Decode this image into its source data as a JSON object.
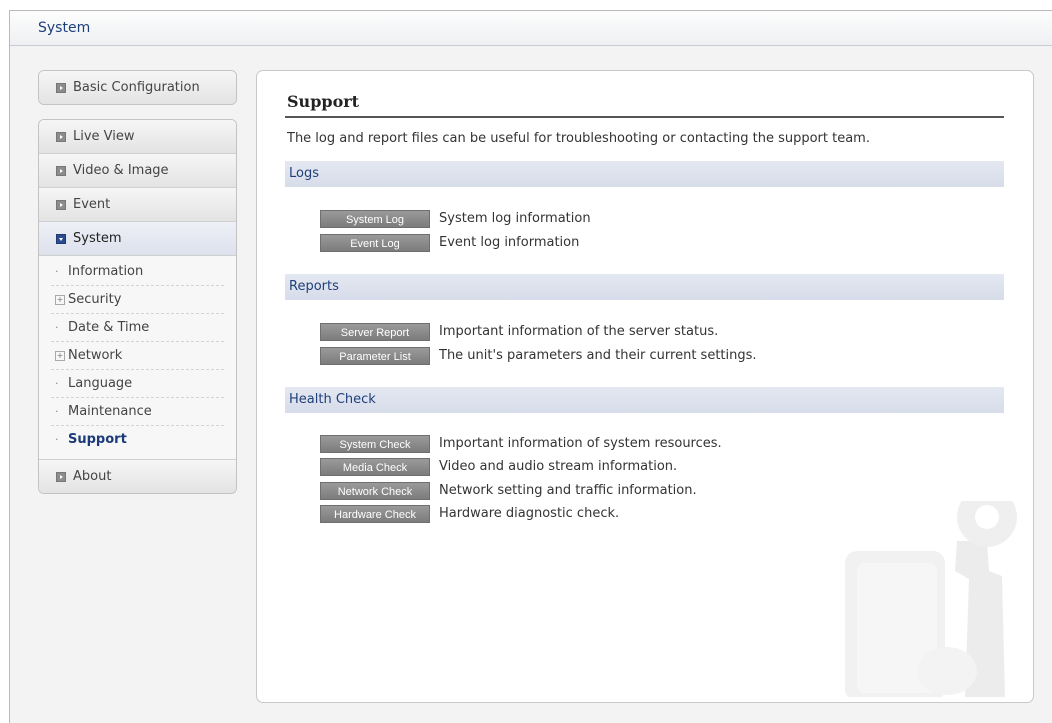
{
  "window": {
    "title": "System"
  },
  "nav": {
    "basic_configuration": "Basic Configuration",
    "live_view": "Live View",
    "video_image": "Video & Image",
    "event": "Event",
    "system": "System",
    "system_items": [
      {
        "label": "Information",
        "type": "dot"
      },
      {
        "label": "Security",
        "type": "plus"
      },
      {
        "label": "Date & Time",
        "type": "dot"
      },
      {
        "label": "Network",
        "type": "plus"
      },
      {
        "label": "Language",
        "type": "dot"
      },
      {
        "label": "Maintenance",
        "type": "dot"
      },
      {
        "label": "Support",
        "type": "dot",
        "active": true
      }
    ],
    "about": "About"
  },
  "main": {
    "title": "Support",
    "intro": "The log and report files can be useful for troubleshooting or contacting the support team.",
    "sections": [
      {
        "heading": "Logs",
        "rows": [
          {
            "button": "System Log",
            "description": "System log information"
          },
          {
            "button": "Event Log",
            "description": "Event log information"
          }
        ]
      },
      {
        "heading": "Reports",
        "rows": [
          {
            "button": "Server Report",
            "description": "Important information of the server status."
          },
          {
            "button": "Parameter List",
            "description": "The unit's parameters and their current settings."
          }
        ]
      },
      {
        "heading": "Health Check",
        "rows": [
          {
            "button": "System Check",
            "description": "Important information of system resources."
          },
          {
            "button": "Media Check",
            "description": "Video and audio stream information."
          },
          {
            "button": "Network Check",
            "description": "Network setting and traffic information."
          },
          {
            "button": "Hardware Check",
            "description": "Hardware diagnostic check."
          }
        ]
      }
    ]
  },
  "colors": {
    "accent": "#1f3f7a",
    "button": "#8a8a8a",
    "section_bg": "#dde1ec"
  },
  "icons": {
    "nav_arrow": "arrow-right-icon",
    "nav_open": "arrow-down-icon",
    "expand": "plus-box-icon",
    "decoration": "tools-watermark-icon"
  }
}
